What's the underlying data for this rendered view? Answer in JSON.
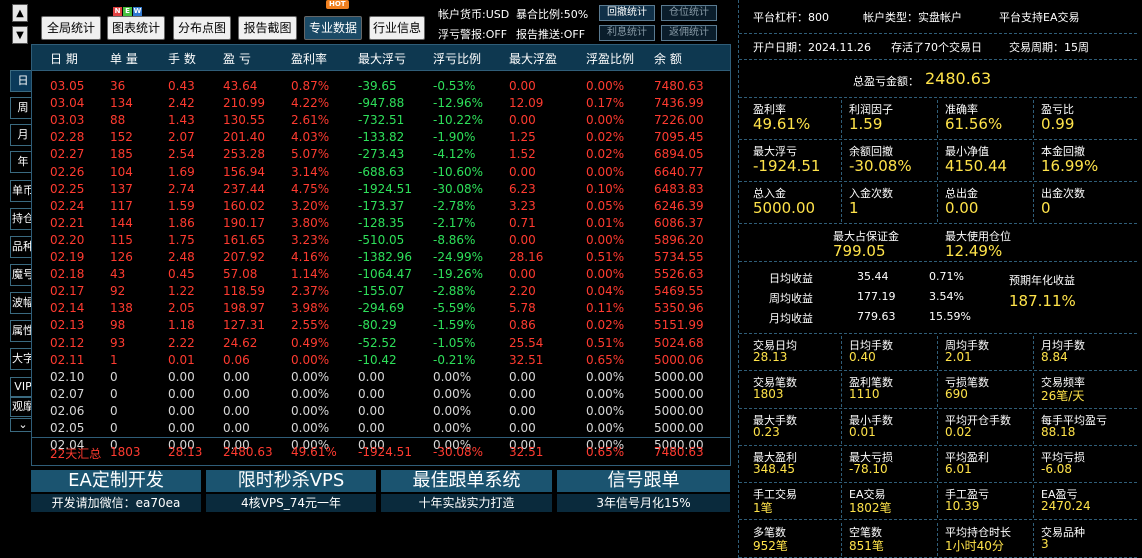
{
  "nav": {
    "up_arrow": "▲",
    "down_arrow": "▼",
    "side_buttons": [
      "日",
      "周",
      "月",
      "年",
      "单币",
      "持仓",
      "品种",
      "魔号",
      "波幅",
      "属性",
      "大字",
      "VIP",
      "观摩",
      "⌄"
    ]
  },
  "toolbar": {
    "buttons": [
      "全局统计",
      "图表统计",
      "分布点图",
      "报告截图",
      "专业数据",
      "行业信息"
    ],
    "new_badge": "NEW",
    "hot_badge": "HOT",
    "currency": "帐户货币:USD",
    "exposure": "暴合比例:50%",
    "float_warning": "浮亏警报:OFF",
    "report_push": "报告推送:OFF",
    "small_buttons": [
      "回撤统计",
      "仓位统计",
      "利息统计",
      "返佣统计"
    ]
  },
  "table": {
    "headers": [
      "日 期",
      "单 量",
      "手 数",
      "盈 亏",
      "盈利率",
      "最大浮亏",
      "浮亏比例",
      "最大浮盈",
      "浮盈比例",
      "余 额"
    ],
    "rows": [
      [
        "03.05",
        "36",
        "0.43",
        "43.64",
        "0.87%",
        "-39.65",
        "-0.53%",
        "0.00",
        "0.00%",
        "7480.63"
      ],
      [
        "03.04",
        "134",
        "2.42",
        "210.99",
        "4.22%",
        "-947.88",
        "-12.96%",
        "12.09",
        "0.17%",
        "7436.99"
      ],
      [
        "03.03",
        "88",
        "1.43",
        "130.55",
        "2.61%",
        "-732.51",
        "-10.22%",
        "0.00",
        "0.00%",
        "7226.00"
      ],
      [
        "02.28",
        "152",
        "2.07",
        "201.40",
        "4.03%",
        "-133.82",
        "-1.90%",
        "1.25",
        "0.02%",
        "7095.45"
      ],
      [
        "02.27",
        "185",
        "2.54",
        "253.28",
        "5.07%",
        "-273.43",
        "-4.12%",
        "1.52",
        "0.02%",
        "6894.05"
      ],
      [
        "02.26",
        "104",
        "1.69",
        "156.94",
        "3.14%",
        "-688.63",
        "-10.60%",
        "0.00",
        "0.00%",
        "6640.77"
      ],
      [
        "02.25",
        "137",
        "2.74",
        "237.44",
        "4.75%",
        "-1924.51",
        "-30.08%",
        "6.23",
        "0.10%",
        "6483.83"
      ],
      [
        "02.24",
        "117",
        "1.59",
        "160.02",
        "3.20%",
        "-173.37",
        "-2.78%",
        "3.23",
        "0.05%",
        "6246.39"
      ],
      [
        "02.21",
        "144",
        "1.86",
        "190.17",
        "3.80%",
        "-128.35",
        "-2.17%",
        "0.71",
        "0.01%",
        "6086.37"
      ],
      [
        "02.20",
        "115",
        "1.75",
        "161.65",
        "3.23%",
        "-510.05",
        "-8.86%",
        "0.00",
        "0.00%",
        "5896.20"
      ],
      [
        "02.19",
        "126",
        "2.48",
        "207.92",
        "4.16%",
        "-1382.96",
        "-24.99%",
        "28.16",
        "0.51%",
        "5734.55"
      ],
      [
        "02.18",
        "43",
        "0.45",
        "57.08",
        "1.14%",
        "-1064.47",
        "-19.26%",
        "0.00",
        "0.00%",
        "5526.63"
      ],
      [
        "02.17",
        "92",
        "1.22",
        "118.59",
        "2.37%",
        "-155.07",
        "-2.88%",
        "2.20",
        "0.04%",
        "5469.55"
      ],
      [
        "02.14",
        "138",
        "2.05",
        "198.97",
        "3.98%",
        "-294.69",
        "-5.59%",
        "5.78",
        "0.11%",
        "5350.96"
      ],
      [
        "02.13",
        "98",
        "1.18",
        "127.31",
        "2.55%",
        "-80.29",
        "-1.59%",
        "0.86",
        "0.02%",
        "5151.99"
      ],
      [
        "02.12",
        "93",
        "2.22",
        "24.62",
        "0.49%",
        "-52.52",
        "-1.05%",
        "25.54",
        "0.51%",
        "5024.68"
      ],
      [
        "02.11",
        "1",
        "0.01",
        "0.06",
        "0.00%",
        "-10.42",
        "-0.21%",
        "32.51",
        "0.65%",
        "5000.06"
      ],
      [
        "02.10",
        "0",
        "0.00",
        "0.00",
        "0.00%",
        "0.00",
        "0.00%",
        "0.00",
        "0.00%",
        "5000.00"
      ],
      [
        "02.07",
        "0",
        "0.00",
        "0.00",
        "0.00%",
        "0.00",
        "0.00%",
        "0.00",
        "0.00%",
        "5000.00"
      ],
      [
        "02.06",
        "0",
        "0.00",
        "0.00",
        "0.00%",
        "0.00",
        "0.00%",
        "0.00",
        "0.00%",
        "5000.00"
      ],
      [
        "02.05",
        "0",
        "0.00",
        "0.00",
        "0.00%",
        "0.00",
        "0.00%",
        "0.00",
        "0.00%",
        "5000.00"
      ],
      [
        "02.04",
        "0",
        "0.00",
        "0.00",
        "0.00%",
        "0.00",
        "0.00%",
        "0.00",
        "0.00%",
        "5000.00"
      ]
    ],
    "active_rows": 17,
    "summary": [
      "22天汇总",
      "1803",
      "28.13",
      "2480.63",
      "49.61%",
      "-1924.51",
      "-30.08%",
      "32.51",
      "0.65%",
      "7480.63"
    ]
  },
  "banners": [
    {
      "title": "EA定制开发",
      "sub": "开发请加微信：ea70ea"
    },
    {
      "title": "限时秒杀VPS",
      "sub": "4核VPS_74元一年"
    },
    {
      "title": "最佳跟单系统",
      "sub": "十年实战实力打造"
    },
    {
      "title": "信号跟单",
      "sub": "3年信号月化15%"
    }
  ],
  "panel": {
    "leverage": "平台杠杆：800",
    "account_type": "帐户类型：实盘帐户",
    "ea_support": "平台支持EA交易",
    "open_date": "开户日期：2024.11.26",
    "alive": "存活了70个交易日",
    "cycle": "交易周期：15周",
    "total_pl_label": "总盈亏金额：",
    "total_pl": "2480.63",
    "grid1": [
      {
        "label": "盈利率",
        "value": "49.61%"
      },
      {
        "label": "利润因子",
        "value": "1.59"
      },
      {
        "label": "准确率",
        "value": "61.56%"
      },
      {
        "label": "盈亏比",
        "value": "0.99"
      },
      {
        "label": "最大浮亏",
        "value": "-1924.51"
      },
      {
        "label": "余额回撤",
        "value": "-30.08%"
      },
      {
        "label": "最小净值",
        "value": "4150.44"
      },
      {
        "label": "本金回撤",
        "value": "16.99%"
      },
      {
        "label": "总入金",
        "value": "5000.00"
      },
      {
        "label": "入金次数",
        "value": "1"
      },
      {
        "label": "总出金",
        "value": "0.00"
      },
      {
        "label": "出金次数",
        "value": "0"
      }
    ],
    "max_margin_label": "最大占保证金",
    "max_margin": "799.05",
    "max_pos_label": "最大使用仓位",
    "max_pos": "12.49%",
    "avg": [
      {
        "label": "日均收益",
        "amt": "35.44",
        "pct": "0.71%"
      },
      {
        "label": "周均收益",
        "amt": "177.19",
        "pct": "3.54%"
      },
      {
        "label": "月均收益",
        "amt": "779.63",
        "pct": "15.59%"
      }
    ],
    "annual_label": "预期年化收益",
    "annual": "187.11%",
    "grid2": [
      {
        "label": "交易日均",
        "value": "28.13"
      },
      {
        "label": "日均手数",
        "value": "0.40"
      },
      {
        "label": "周均手数",
        "value": "2.01"
      },
      {
        "label": "月均手数",
        "value": "8.84"
      },
      {
        "label": "交易笔数",
        "value": "1803"
      },
      {
        "label": "盈利笔数",
        "value": "1110"
      },
      {
        "label": "亏损笔数",
        "value": "690"
      },
      {
        "label": "交易频率",
        "value": "26笔/天"
      },
      {
        "label": "最大手数",
        "value": "0.23"
      },
      {
        "label": "最小手数",
        "value": "0.01"
      },
      {
        "label": "平均开仓手数",
        "value": "0.02"
      },
      {
        "label": "每手平均盈亏",
        "value": "88.18"
      },
      {
        "label": "最大盈利",
        "value": "348.45"
      },
      {
        "label": "最大亏损",
        "value": "-78.10"
      },
      {
        "label": "平均盈利",
        "value": "6.01"
      },
      {
        "label": "平均亏损",
        "value": "-6.08"
      },
      {
        "label": "手工交易",
        "value": "1笔"
      },
      {
        "label": "EA交易",
        "value": "1802笔"
      },
      {
        "label": "手工盈亏",
        "value": "10.39"
      },
      {
        "label": "EA盈亏",
        "value": "2470.24"
      },
      {
        "label": "多笔数",
        "value": "952笔"
      },
      {
        "label": "空笔数",
        "value": "851笔"
      },
      {
        "label": "平均持仓时长",
        "value": "1小时40分"
      },
      {
        "label": "交易品种",
        "value": "3"
      }
    ]
  }
}
